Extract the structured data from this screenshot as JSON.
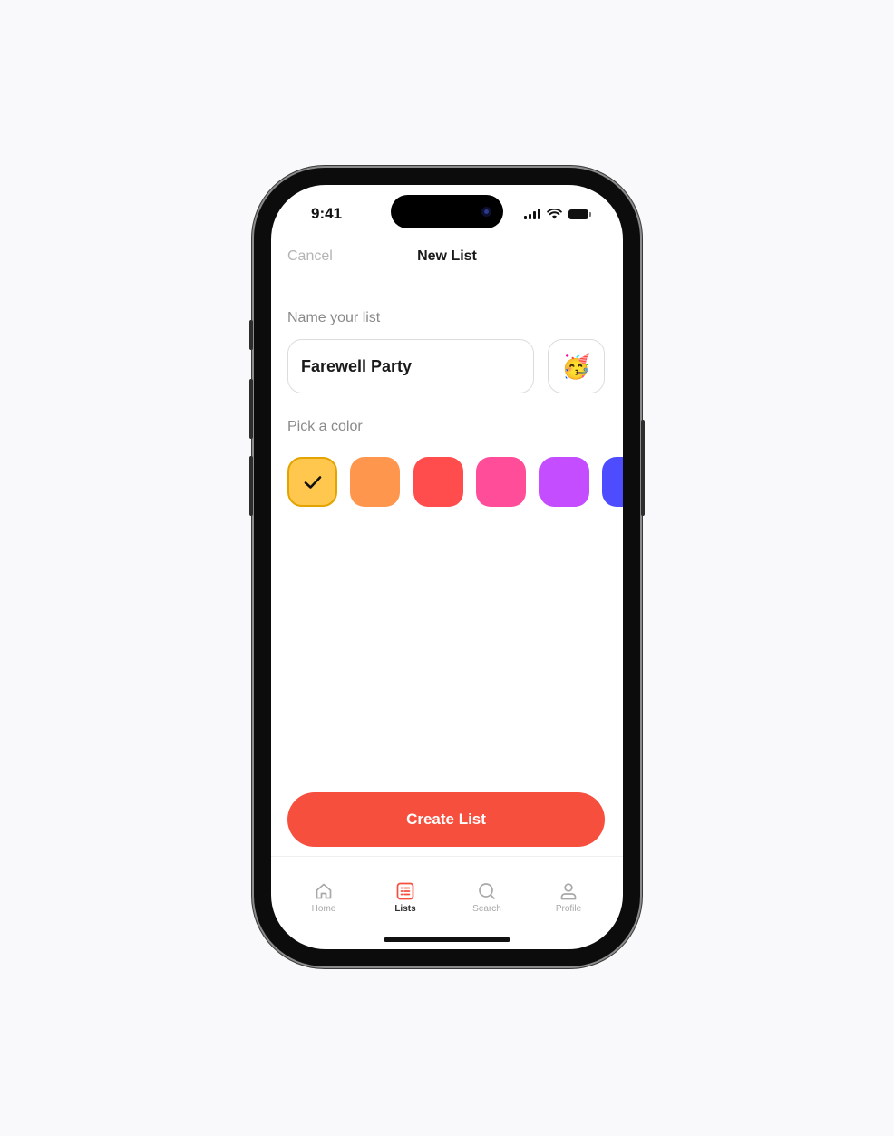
{
  "status_bar": {
    "time": "9:41"
  },
  "nav": {
    "cancel_label": "Cancel",
    "title": "New List"
  },
  "name_section": {
    "label": "Name your list",
    "value": "Farewell Party",
    "emoji": "🥳"
  },
  "color_section": {
    "label": "Pick a color",
    "colors": [
      "#ffc74d",
      "#ff964d",
      "#ff4d4d",
      "#ff4d9a",
      "#c44dff",
      "#4d4dff"
    ],
    "selected_index": 0
  },
  "create_button": {
    "label": "Create List",
    "color": "#f74f3e"
  },
  "tab_bar": {
    "tabs": [
      {
        "label": "Home",
        "icon": "home-icon",
        "active": false
      },
      {
        "label": "Lists",
        "icon": "list-icon",
        "active": true
      },
      {
        "label": "Search",
        "icon": "search-icon",
        "active": false
      },
      {
        "label": "Profile",
        "icon": "profile-icon",
        "active": false
      }
    ],
    "active_color": "#f74f3e"
  }
}
